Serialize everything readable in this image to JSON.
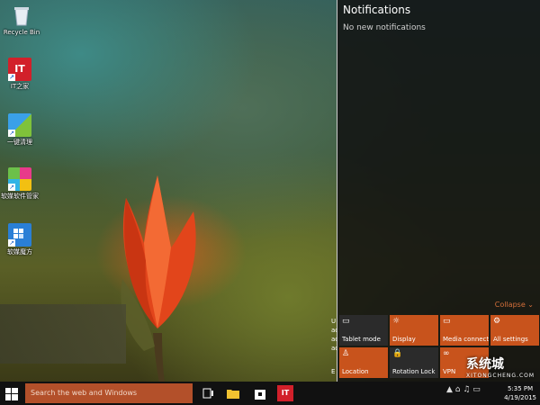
{
  "desktop": {
    "icons": [
      {
        "label": "Recycle Bin",
        "icon": "recycle-bin-icon"
      },
      {
        "label": "IT之家",
        "icon": "ithome-icon"
      },
      {
        "label": "一键清理",
        "icon": "cleanup-icon"
      },
      {
        "label": "软媒软件管家",
        "icon": "software-manager-icon"
      },
      {
        "label": "软媒魔方",
        "icon": "rubik-icon"
      }
    ],
    "behind_text": [
      "U",
      "ac",
      "ac",
      "ac",
      "E"
    ]
  },
  "action_center": {
    "title": "Notifications",
    "empty_text": "No new notifications",
    "collapse_label": "Collapse",
    "tiles": [
      {
        "label": "Tablet mode",
        "icon": "tablet-mode-icon",
        "glyph": "▭",
        "active": false
      },
      {
        "label": "Display",
        "icon": "display-icon",
        "glyph": "☼",
        "active": true
      },
      {
        "label": "Media connect",
        "icon": "media-connect-icon",
        "glyph": "▭",
        "active": true
      },
      {
        "label": "All settings",
        "icon": "settings-icon",
        "glyph": "⚙",
        "active": true
      },
      {
        "label": "Location",
        "icon": "location-icon",
        "glyph": "♙",
        "active": true
      },
      {
        "label": "Rotation Lock",
        "icon": "rotation-lock-icon",
        "glyph": "🔒",
        "active": false
      },
      {
        "label": "VPN",
        "icon": "vpn-icon",
        "glyph": "∞",
        "active": true
      }
    ],
    "accent": "#c8531c"
  },
  "taskbar": {
    "search_placeholder": "Search the web and Windows",
    "pinned": [
      {
        "icon": "task-view-icon"
      },
      {
        "icon": "file-explorer-icon"
      },
      {
        "icon": "store-icon"
      },
      {
        "icon": "ithome-app-icon",
        "label": "IT"
      }
    ],
    "tray_glyphs": "▲ ⌂ ♫ ▭",
    "time": "5:35 PM",
    "date": "4/19/2015"
  },
  "watermark": {
    "brand": "系统城",
    "site": "XITONGCHENG.COM"
  }
}
